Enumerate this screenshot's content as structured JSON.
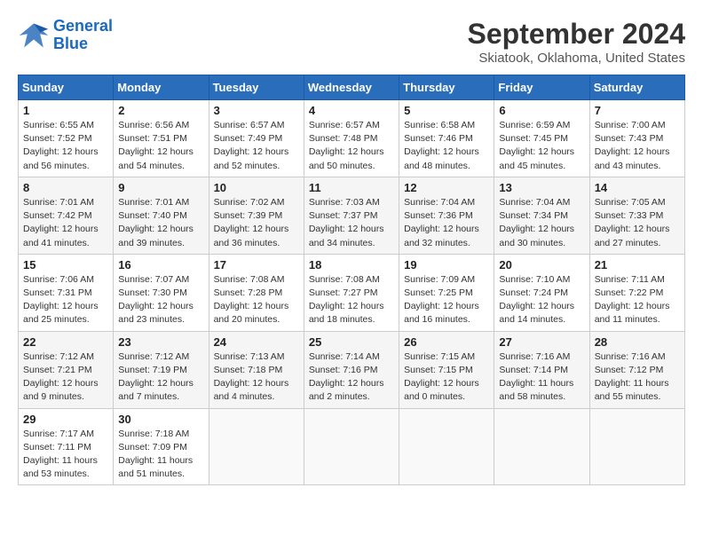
{
  "header": {
    "logo": {
      "line1": "General",
      "line2": "Blue"
    },
    "title": "September 2024",
    "subtitle": "Skiatook, Oklahoma, United States"
  },
  "weekdays": [
    "Sunday",
    "Monday",
    "Tuesday",
    "Wednesday",
    "Thursday",
    "Friday",
    "Saturday"
  ],
  "weeks": [
    [
      {
        "day": 1,
        "info": "Sunrise: 6:55 AM\nSunset: 7:52 PM\nDaylight: 12 hours\nand 56 minutes."
      },
      {
        "day": 2,
        "info": "Sunrise: 6:56 AM\nSunset: 7:51 PM\nDaylight: 12 hours\nand 54 minutes."
      },
      {
        "day": 3,
        "info": "Sunrise: 6:57 AM\nSunset: 7:49 PM\nDaylight: 12 hours\nand 52 minutes."
      },
      {
        "day": 4,
        "info": "Sunrise: 6:57 AM\nSunset: 7:48 PM\nDaylight: 12 hours\nand 50 minutes."
      },
      {
        "day": 5,
        "info": "Sunrise: 6:58 AM\nSunset: 7:46 PM\nDaylight: 12 hours\nand 48 minutes."
      },
      {
        "day": 6,
        "info": "Sunrise: 6:59 AM\nSunset: 7:45 PM\nDaylight: 12 hours\nand 45 minutes."
      },
      {
        "day": 7,
        "info": "Sunrise: 7:00 AM\nSunset: 7:43 PM\nDaylight: 12 hours\nand 43 minutes."
      }
    ],
    [
      {
        "day": 8,
        "info": "Sunrise: 7:01 AM\nSunset: 7:42 PM\nDaylight: 12 hours\nand 41 minutes."
      },
      {
        "day": 9,
        "info": "Sunrise: 7:01 AM\nSunset: 7:40 PM\nDaylight: 12 hours\nand 39 minutes."
      },
      {
        "day": 10,
        "info": "Sunrise: 7:02 AM\nSunset: 7:39 PM\nDaylight: 12 hours\nand 36 minutes."
      },
      {
        "day": 11,
        "info": "Sunrise: 7:03 AM\nSunset: 7:37 PM\nDaylight: 12 hours\nand 34 minutes."
      },
      {
        "day": 12,
        "info": "Sunrise: 7:04 AM\nSunset: 7:36 PM\nDaylight: 12 hours\nand 32 minutes."
      },
      {
        "day": 13,
        "info": "Sunrise: 7:04 AM\nSunset: 7:34 PM\nDaylight: 12 hours\nand 30 minutes."
      },
      {
        "day": 14,
        "info": "Sunrise: 7:05 AM\nSunset: 7:33 PM\nDaylight: 12 hours\nand 27 minutes."
      }
    ],
    [
      {
        "day": 15,
        "info": "Sunrise: 7:06 AM\nSunset: 7:31 PM\nDaylight: 12 hours\nand 25 minutes."
      },
      {
        "day": 16,
        "info": "Sunrise: 7:07 AM\nSunset: 7:30 PM\nDaylight: 12 hours\nand 23 minutes."
      },
      {
        "day": 17,
        "info": "Sunrise: 7:08 AM\nSunset: 7:28 PM\nDaylight: 12 hours\nand 20 minutes."
      },
      {
        "day": 18,
        "info": "Sunrise: 7:08 AM\nSunset: 7:27 PM\nDaylight: 12 hours\nand 18 minutes."
      },
      {
        "day": 19,
        "info": "Sunrise: 7:09 AM\nSunset: 7:25 PM\nDaylight: 12 hours\nand 16 minutes."
      },
      {
        "day": 20,
        "info": "Sunrise: 7:10 AM\nSunset: 7:24 PM\nDaylight: 12 hours\nand 14 minutes."
      },
      {
        "day": 21,
        "info": "Sunrise: 7:11 AM\nSunset: 7:22 PM\nDaylight: 12 hours\nand 11 minutes."
      }
    ],
    [
      {
        "day": 22,
        "info": "Sunrise: 7:12 AM\nSunset: 7:21 PM\nDaylight: 12 hours\nand 9 minutes."
      },
      {
        "day": 23,
        "info": "Sunrise: 7:12 AM\nSunset: 7:19 PM\nDaylight: 12 hours\nand 7 minutes."
      },
      {
        "day": 24,
        "info": "Sunrise: 7:13 AM\nSunset: 7:18 PM\nDaylight: 12 hours\nand 4 minutes."
      },
      {
        "day": 25,
        "info": "Sunrise: 7:14 AM\nSunset: 7:16 PM\nDaylight: 12 hours\nand 2 minutes."
      },
      {
        "day": 26,
        "info": "Sunrise: 7:15 AM\nSunset: 7:15 PM\nDaylight: 12 hours\nand 0 minutes."
      },
      {
        "day": 27,
        "info": "Sunrise: 7:16 AM\nSunset: 7:14 PM\nDaylight: 11 hours\nand 58 minutes."
      },
      {
        "day": 28,
        "info": "Sunrise: 7:16 AM\nSunset: 7:12 PM\nDaylight: 11 hours\nand 55 minutes."
      }
    ],
    [
      {
        "day": 29,
        "info": "Sunrise: 7:17 AM\nSunset: 7:11 PM\nDaylight: 11 hours\nand 53 minutes."
      },
      {
        "day": 30,
        "info": "Sunrise: 7:18 AM\nSunset: 7:09 PM\nDaylight: 11 hours\nand 51 minutes."
      },
      null,
      null,
      null,
      null,
      null
    ]
  ]
}
